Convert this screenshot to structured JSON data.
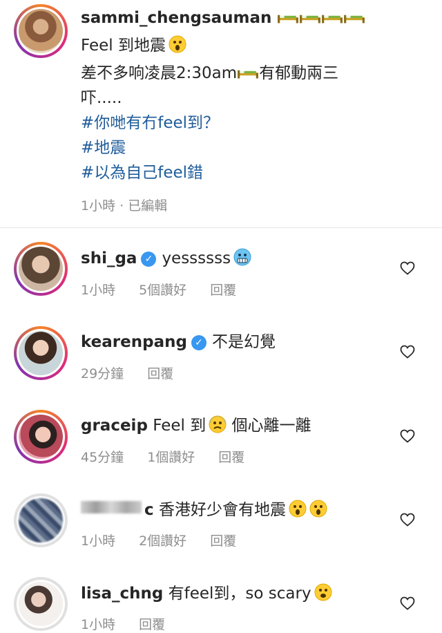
{
  "post": {
    "username": "sammi_chengsauman",
    "line1": "Feel 到地震",
    "line2a": "差不多响凌晨2:30am",
    "line2b": "有郁動兩三",
    "line3": "吓.....",
    "hashtags": [
      "#你哋有冇feel到？",
      "#地震",
      "#以為自己feel錯"
    ],
    "meta": "1小時 · 已編輯"
  },
  "comments": [
    {
      "username": "shi_ga",
      "verified": true,
      "text": "yessssss",
      "time": "1小時",
      "likes": "5個讚好",
      "reply": "回覆"
    },
    {
      "username": "kearenpang",
      "verified": true,
      "text": "不是幻覺",
      "time": "29分鐘",
      "likes": "",
      "reply": "回覆"
    },
    {
      "username": "graceip",
      "verified": false,
      "text": "Feel 到",
      "text2": "個心離一離",
      "time": "45分鐘",
      "likes": "1個讚好",
      "reply": "回覆"
    },
    {
      "username": "c",
      "verified": false,
      "text": "香港好少會有地震",
      "time": "1小時",
      "likes": "2個讚好",
      "reply": "回覆"
    },
    {
      "username": "lisa_chng",
      "verified": false,
      "text": "有feel到，so scary",
      "time": "1小時",
      "likes": "",
      "reply": "回覆"
    }
  ],
  "colors": {
    "hashtag": "#1f5c9a",
    "meta": "#8e8e8e",
    "verified": "#3897f0"
  },
  "icons": [
    "bed-icon",
    "astonished-emoji",
    "cold-face-emoji",
    "fearful-emoji",
    "frowning-open-mouth-emoji",
    "heart-outline-icon",
    "verified-badge-icon"
  ]
}
